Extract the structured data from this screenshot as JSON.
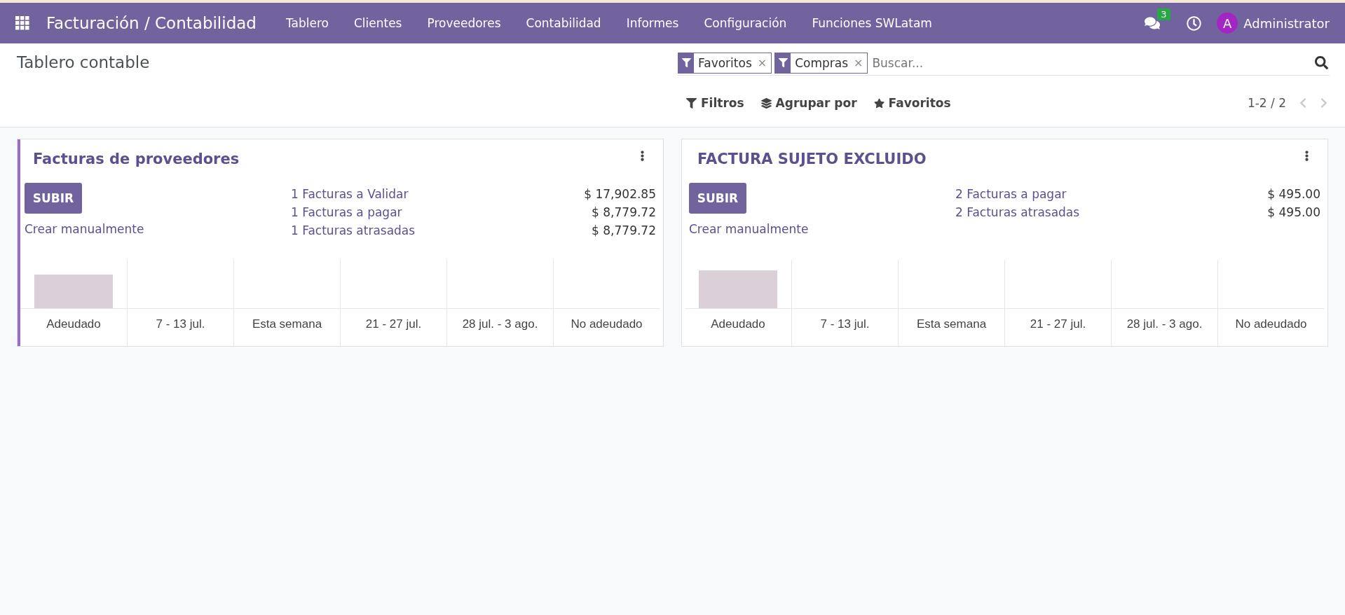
{
  "navbar": {
    "app_title": "Facturación / Contabilidad",
    "menu": [
      "Tablero",
      "Clientes",
      "Proveedores",
      "Contabilidad",
      "Informes",
      "Configuración",
      "Funciones SWLatam"
    ],
    "messages_count": "3",
    "user_initial": "A",
    "user_name": "Administrator"
  },
  "control_panel": {
    "title": "Tablero contable",
    "facets": [
      {
        "label": "Favoritos",
        "remove": "×"
      },
      {
        "label": "Compras",
        "remove": "×"
      }
    ],
    "search": {
      "placeholder": "Buscar..."
    },
    "buttons": [
      "Filtros",
      "Agrupar por",
      "Favoritos"
    ],
    "pager": "1-2 / 2"
  },
  "cards": [
    {
      "title": "Facturas de proveedores",
      "highlighted": true,
      "upload_button": "SUBIR",
      "manual_link": "Crear manualmente",
      "lines": [
        {
          "label": "1 Facturas a Validar",
          "amount": "$ 17,902.85"
        },
        {
          "label": "1 Facturas a pagar",
          "amount": "$ 8,779.72"
        },
        {
          "label": "1 Facturas atrasadas",
          "amount": "$ 8,779.72"
        }
      ],
      "chart_labels": [
        "Adeudado",
        "7 - 13 jul.",
        "Esta semana",
        "21 - 27 jul.",
        "28 jul. - 3 ago.",
        "No adeudado"
      ]
    },
    {
      "title": "FACTURA SUJETO EXCLUIDO",
      "highlighted": false,
      "upload_button": "SUBIR",
      "manual_link": "Crear manualmente",
      "lines": [
        {
          "label": "2 Facturas a pagar",
          "amount": "$ 495.00"
        },
        {
          "label": "2 Facturas atrasadas",
          "amount": "$ 495.00"
        }
      ],
      "chart_labels": [
        "Adeudado",
        "7 - 13 jul.",
        "Esta semana",
        "21 - 27 jul.",
        "28 jul. - 3 ago.",
        "No adeudado"
      ]
    }
  ]
}
